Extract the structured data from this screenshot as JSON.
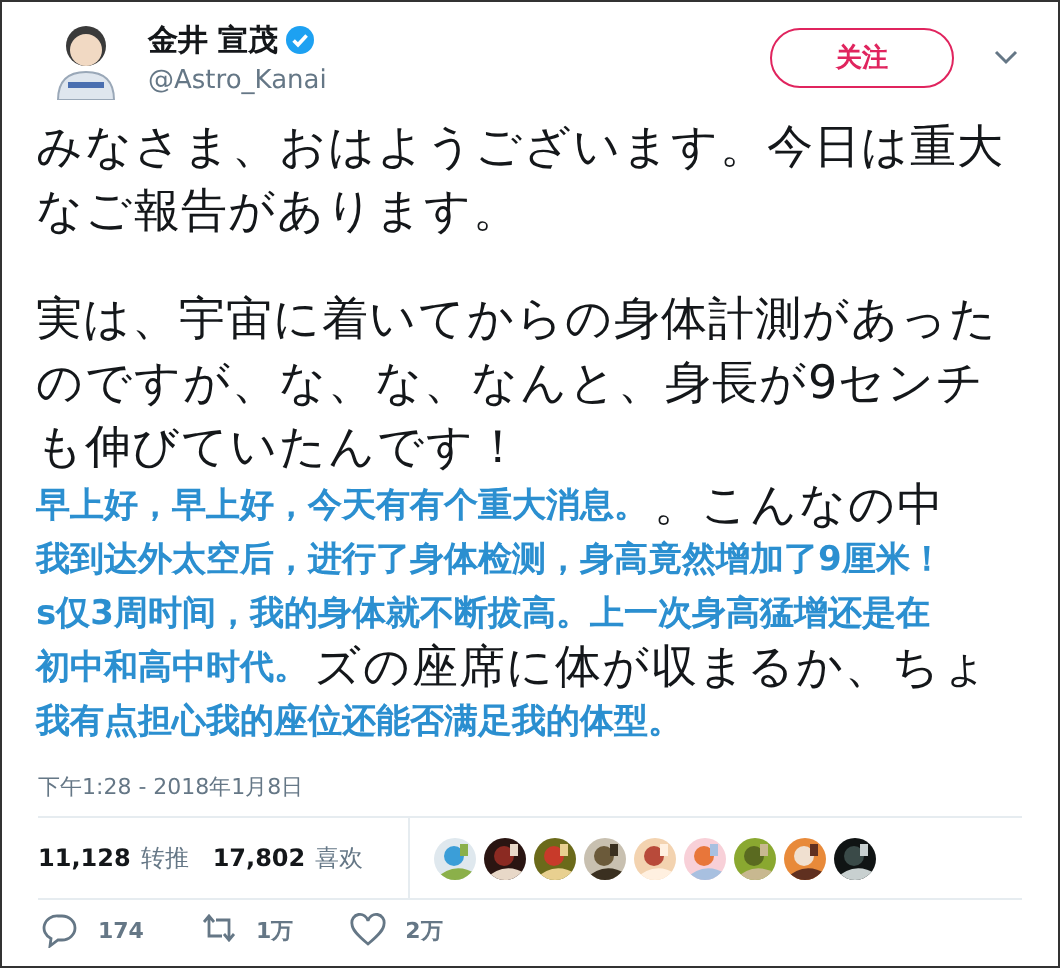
{
  "author": {
    "name": "金井 宣茂",
    "handle": "@Astro_Kanai",
    "verified": true
  },
  "follow_button": "关注",
  "tweet": {
    "paragraphs": [
      [
        {
          "text": "みなさま、おはようございます。今日は重大"
        },
        {
          "text": "なご報告があります。"
        }
      ],
      [
        {
          "text": "実は、宇宙に着いてからの身体計測があった"
        },
        {
          "text": "のですが、な、な、なんと、身長が9センチ"
        },
        {
          "text": "も伸びていたんです！"
        },
        {
          "subtitle": "早上好，早上好，今天有有个重大消息。",
          "text": "。こんなの中"
        },
        {
          "subtitle": "我到达外太空后，进行了身体检测，身高竟然增加了9厘米！"
        },
        {
          "subtitle": "s仅3周时间，我的身体就不断拔高。上一次身高猛增还是在"
        },
        {
          "subtitle": "初中和高中时代。",
          "text": "ズの座席に体が収まるか、ちょ"
        },
        {
          "subtitle": "我有点担心我的座位还能否满足我的体型。"
        }
      ]
    ]
  },
  "timestamp": "下午1:28 - 2018年1月8日",
  "stats": [
    {
      "count": "11,128",
      "label": "转推"
    },
    {
      "count": "17,802",
      "label": "喜欢"
    }
  ],
  "actions": [
    {
      "kind": "reply",
      "count": "174"
    },
    {
      "kind": "retweet",
      "count": "1万"
    },
    {
      "kind": "like",
      "count": "2万"
    }
  ]
}
